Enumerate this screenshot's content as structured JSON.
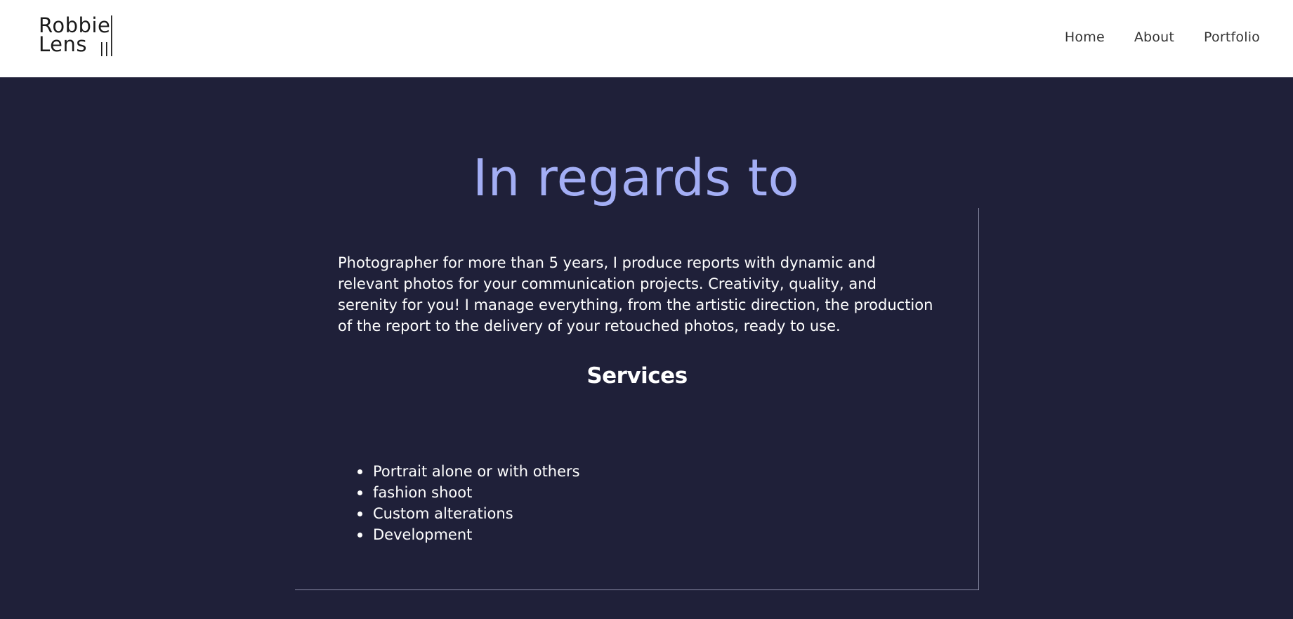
{
  "header": {
    "logo": {
      "line1": "Robbie",
      "line2": "Lens"
    },
    "nav": [
      {
        "label": "Home"
      },
      {
        "label": "About"
      },
      {
        "label": "Portfolio"
      }
    ]
  },
  "main": {
    "title": "In regards to",
    "intro": "Photographer for more than 5 years, I produce reports with dynamic and relevant photos for your communication projects. Creativity, quality, and serenity for you! I manage everything, from the artistic direction, the production of the report to the delivery of your retouched photos, ready to use.",
    "services_title": "Services",
    "services": [
      "Portrait alone or with others",
      "fashion shoot",
      "Custom alterations",
      "Development"
    ]
  },
  "colors": {
    "background": "#1f2039",
    "header_background": "#ffffff",
    "title_accent": "#a3aef5",
    "text": "#ffffff"
  }
}
